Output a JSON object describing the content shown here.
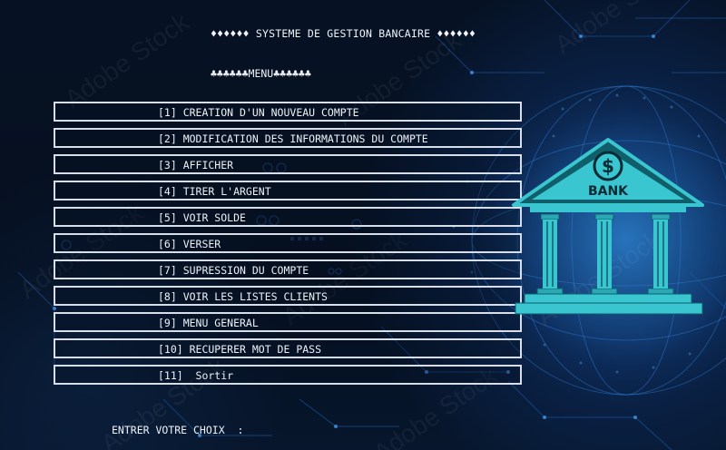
{
  "header": {
    "title": "♦♦♦♦♦♦ SYSTEME DE GESTION BANCAIRE ♦♦♦♦♦♦",
    "menu_title": "♣♣♣♣♣♣MENU♣♣♣♣♣♣"
  },
  "menu": {
    "items": [
      {
        "label": "[1] CREATION D'UN NOUVEAU COMPTE"
      },
      {
        "label": "[2] MODIFICATION DES INFORMATIONS DU COMPTE"
      },
      {
        "label": "[3] AFFICHER"
      },
      {
        "label": "[4] TIRER L'ARGENT"
      },
      {
        "label": "[5] VOIR SOLDE"
      },
      {
        "label": "[6] VERSER"
      },
      {
        "label": "[7] SUPRESSION DU COMPTE"
      },
      {
        "label": "[8] VOIR LES LISTES CLIENTS"
      },
      {
        "label": "[9] MENU GENERAL"
      },
      {
        "label": "[10] RECUPERER MOT DE PASS"
      },
      {
        "label": "[11]  Sortir"
      }
    ]
  },
  "prompt": {
    "label": "ENTRER VOTRE CHOIX  :"
  },
  "illustration": {
    "bank_text": "BANK",
    "coin_symbol": "$",
    "icon": "bank-building-icon",
    "colors": {
      "bank_teal": "#39c6d0",
      "bank_dark": "#0f5e6a",
      "background": "#061224",
      "glow": "#2a82dc"
    }
  },
  "watermark": {
    "text": "Adobe Stock"
  }
}
